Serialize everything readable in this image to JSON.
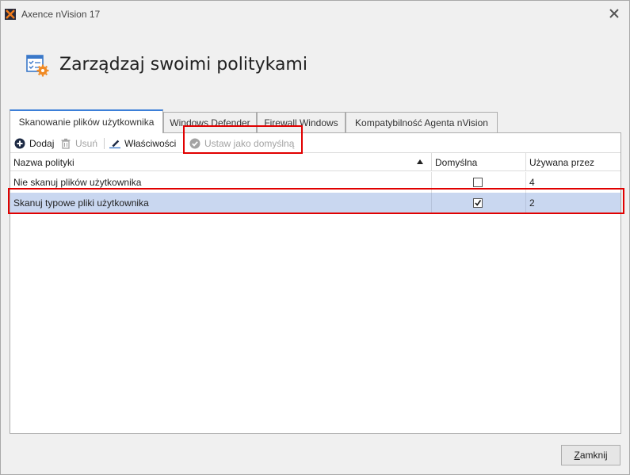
{
  "window": {
    "title": "Axence nVision 17"
  },
  "header": {
    "title": "Zarządzaj swoimi politykami"
  },
  "tabs": [
    {
      "label": "Skanowanie plików użytkownika",
      "active": true
    },
    {
      "label": "Windows Defender",
      "active": false
    },
    {
      "label": "Firewall Windows",
      "active": false
    },
    {
      "label": "Kompatybilność Agenta nVision",
      "active": false
    }
  ],
  "toolbar": {
    "add_label": "Dodaj",
    "delete_label": "Usuń",
    "properties_label": "Właściwości",
    "set_default_label": "Ustaw jako domyślną"
  },
  "grid": {
    "columns": [
      "Nazwa polityki",
      "Domyślna",
      "Używana przez"
    ],
    "rows": [
      {
        "name": "Nie skanuj plików użytkownika",
        "default": false,
        "used_by": "4",
        "selected": false
      },
      {
        "name": "Skanuj typowe pliki użytkownika",
        "default": true,
        "used_by": "2",
        "selected": true
      }
    ]
  },
  "footer": {
    "close_label_prefix": "",
    "close_label_underlined": "Z",
    "close_label_rest": "amknij"
  },
  "colors": {
    "accent": "#3c7fd8",
    "selection": "#c9d7f0",
    "highlight": "#e10000",
    "header_icon": "#3a78c9",
    "gear": "#f08a24"
  }
}
